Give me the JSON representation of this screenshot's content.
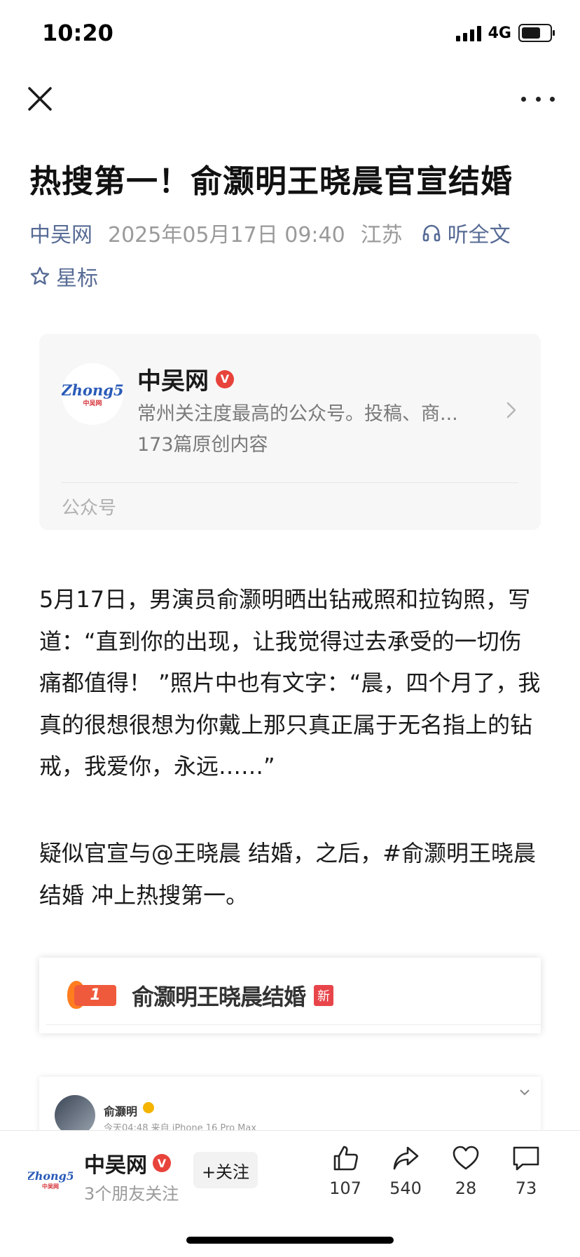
{
  "status_bar": {
    "time": "10:20",
    "network": "4G"
  },
  "article": {
    "title": "热搜第一！俞灏明王晓晨官宣结婚",
    "source": "中吴网",
    "date": "2025年05月17日 09:40",
    "location": "江苏",
    "listen_label": "听全文",
    "star_label": "星标"
  },
  "account_card": {
    "logo_text": "Zhong5",
    "logo_sub": "中吴网",
    "name": "中吴网",
    "verified_mark": "V",
    "description": "常州关注度最高的公众号。投稿、商...",
    "original_count": "173篇原创内容",
    "type_label": "公众号"
  },
  "paragraphs": [
    "5月17日，男演员俞灏明晒出钻戒照和拉钩照，写道：“直到你的出现，让我觉得过去承受的一切伤痛都值得！ ”照片中也有文字：“晨，四个月了，我真的很想很想为你戴上那只真正属于无名指上的钻戒，我爱你，永远……”",
    "疑似官宣与@王晓晨 结婚，之后，#俞灏明王晓晨结婚 冲上热搜第一。"
  ],
  "hot_search_image": {
    "rank": "1",
    "keyword": "俞灏明王晓晨结婚",
    "new_badge": "新"
  },
  "weibo_card": {
    "user": "俞灏明",
    "time_source": "今天04:48  来自 iPhone 16 Pro Max"
  },
  "bottom_bar": {
    "account_name": "中吴网",
    "friends_following": "3个朋友关注",
    "follow_label": "+关注",
    "likes": "107",
    "shares": "540",
    "favorites": "28",
    "comments": "73"
  },
  "colors": {
    "link": "#576b95",
    "verified": "#e8433b",
    "hot": "#f05a3c"
  }
}
